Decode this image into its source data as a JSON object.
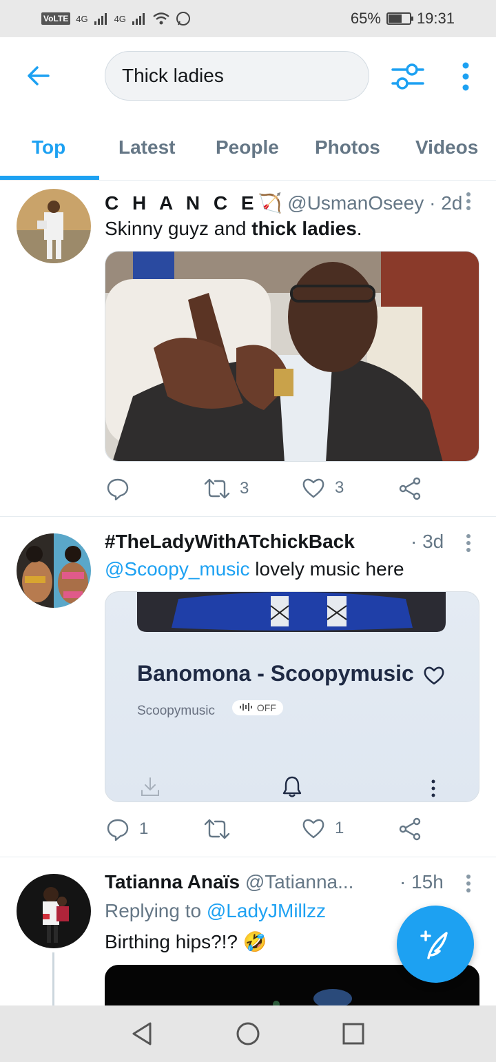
{
  "status_bar": {
    "left_label": "VoLTE",
    "network_1": "4G",
    "network_2": "4G",
    "battery_percent": "65%",
    "battery_level": 0.65,
    "time": "19:31"
  },
  "search": {
    "query": "Thick ladies"
  },
  "tabs": [
    {
      "label": "Top",
      "active": true
    },
    {
      "label": "Latest",
      "active": false
    },
    {
      "label": "People",
      "active": false
    },
    {
      "label": "Photos",
      "active": false
    },
    {
      "label": "Videos",
      "active": false
    }
  ],
  "tweets": [
    {
      "name": "C H A N C E",
      "name_emoji": "🏹",
      "handle": "@UsmanOseey",
      "time": "· 2d",
      "text_plain": "Skinny guyz and ",
      "text_bold": "thick ladies",
      "text_end": ".",
      "replies": "",
      "retweets": "3",
      "likes": "3"
    },
    {
      "name": "#TheLadyWithATchickBack",
      "handle": "",
      "time": "· 3d",
      "text_link": "@Scoopy_music",
      "text_plain": " lovely music here",
      "music_title": "Banomona - Scoopymusic",
      "music_artist": "Scoopymusic",
      "music_badge": "OFF",
      "replies": "1",
      "retweets": "",
      "likes": "1"
    },
    {
      "name": "Tatianna Anaïs",
      "handle": "@Tatianna...",
      "time": "· 15h",
      "reply_prefix": "Replying to ",
      "reply_to": "@LadyJMillzz",
      "text_plain": "Birthing hips?!? ",
      "text_emoji": "🤣"
    }
  ],
  "colors": {
    "accent": "#1da1f2",
    "text_primary": "#14171a",
    "text_secondary": "#657786"
  }
}
